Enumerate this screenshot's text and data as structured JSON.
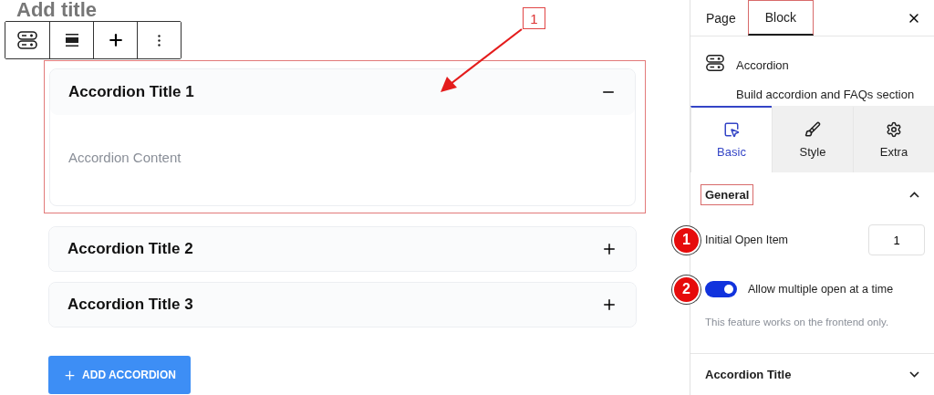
{
  "editor": {
    "post_title": "Add title",
    "toolbar": [
      {
        "kind": "block"
      },
      {
        "kind": "align"
      },
      {
        "kind": "add"
      },
      {
        "kind": "more"
      }
    ],
    "accordion_items": [
      {
        "title": "Accordion Title 1",
        "expanded": true,
        "highlighted": true,
        "content": "Accordion Content"
      },
      {
        "title": "Accordion Title 2",
        "expanded": false,
        "highlighted": false
      },
      {
        "title": "Accordion Title 3",
        "expanded": false,
        "highlighted": false
      }
    ],
    "add_button": "ADD ACCORDION",
    "callout": "1"
  },
  "sidebar": {
    "tabs": [
      {
        "label": "Page",
        "selected": false,
        "highlighted": false
      },
      {
        "label": "Block",
        "selected": true,
        "highlighted": true
      }
    ],
    "block": {
      "name": "Accordion",
      "description": "Build accordion and FAQs section"
    },
    "panel_tabs": [
      {
        "label": "Basic",
        "kind": "cursor",
        "selected": true
      },
      {
        "label": "Style",
        "kind": "brush",
        "selected": false
      },
      {
        "label": "Extra",
        "kind": "gear",
        "selected": false
      }
    ],
    "sections": [
      {
        "title": "General",
        "expanded": true,
        "highlighted": true,
        "fields": [
          {
            "kind": "number",
            "badge": "1",
            "label": "Initial Open Item",
            "value": "1"
          },
          {
            "kind": "toggle",
            "badge": "2",
            "label": "Allow multiple open at a time",
            "on": true,
            "help": "This feature works on the frontend only."
          }
        ]
      },
      {
        "title": "Accordion Title",
        "expanded": false,
        "highlighted": false
      }
    ]
  }
}
